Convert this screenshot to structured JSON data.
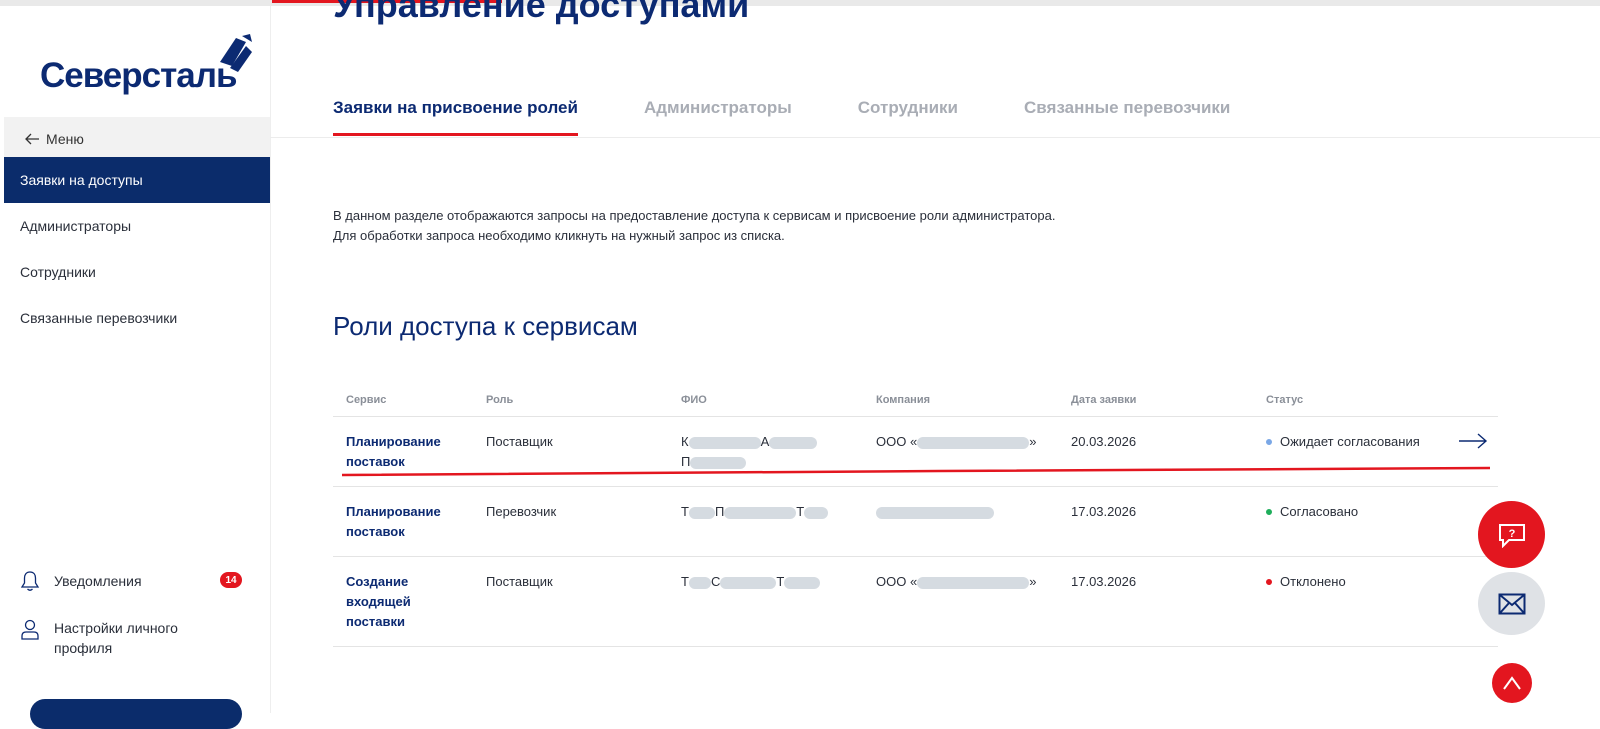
{
  "logo": {
    "text": "Северсталь"
  },
  "sidebar": {
    "back_label": "Меню",
    "items": [
      {
        "label": "Заявки на доступы",
        "active": true
      },
      {
        "label": "Администраторы",
        "active": false
      },
      {
        "label": "Сотрудники",
        "active": false
      },
      {
        "label": "Связанные перевозчики",
        "active": false
      }
    ],
    "notifications": {
      "label": "Уведомления",
      "count": "14"
    },
    "profile_settings": {
      "label": "Настройки личного профиля"
    }
  },
  "main": {
    "title": "Управление доступами",
    "tabs": [
      {
        "label": "Заявки на присвоение ролей",
        "active": true
      },
      {
        "label": "Администраторы",
        "active": false
      },
      {
        "label": "Сотрудники",
        "active": false
      },
      {
        "label": "Связанные перевозчики",
        "active": false
      }
    ],
    "description": {
      "line1": "В данном разделе отображаются запросы на предоставление доступа к сервисам и присвоение роли администратора.",
      "line2": "Для обработки запроса необходимо кликнуть на нужный запрос из списка."
    },
    "section_title": "Роли доступа к сервисам",
    "table": {
      "headers": [
        "Сервис",
        "Роль",
        "ФИО",
        "Компания",
        "Дата заявки",
        "Статус"
      ],
      "rows": [
        {
          "service": "Планирование поставок",
          "role": "Поставщик",
          "fio_initials": [
            "К",
            "А",
            "П"
          ],
          "company_prefix": "ООО «",
          "company_suffix": "»",
          "date": "20.03.2026",
          "status": "Ожидает согласования",
          "status_color": "#7aa7e6"
        },
        {
          "service": "Планирование поставок",
          "role": "Перевозчик",
          "fio_initials": [
            "Т",
            "П",
            "Т"
          ],
          "company_prefix": "",
          "company_suffix": "",
          "date": "17.03.2026",
          "status": "Согласовано",
          "status_color": "#1fae5b"
        },
        {
          "service": "Создание входящей поставки",
          "role": "Поставщик",
          "fio_initials": [
            "Т",
            "С",
            "Т"
          ],
          "company_prefix": "ООО «",
          "company_suffix": "»",
          "date": "17.03.2026",
          "status": "Отклонено",
          "status_color": "#e3161f"
        }
      ]
    }
  },
  "colors": {
    "brand": "#0c2a72",
    "accent": "#e3161f",
    "nav_active": "#0b2c6b"
  },
  "icons": [
    "back-arrow-icon",
    "bell-icon",
    "user-icon",
    "arrow-right-icon",
    "help-chat-icon",
    "mail-icon",
    "arrow-up-icon"
  ]
}
